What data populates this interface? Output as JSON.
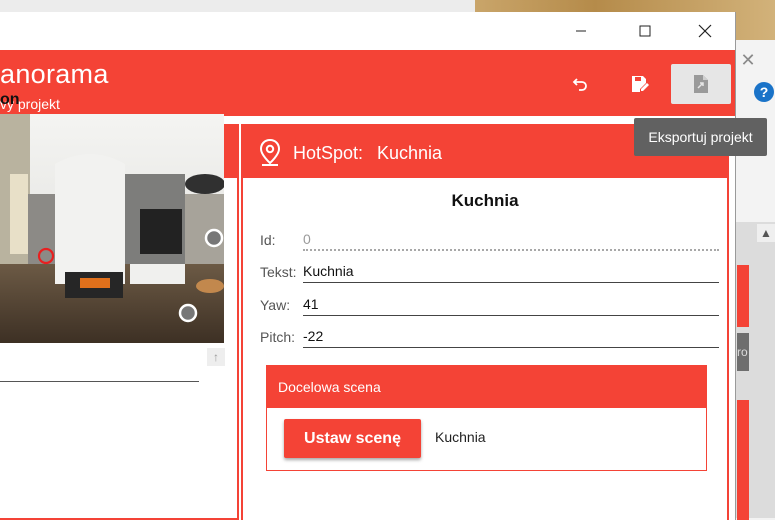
{
  "app": {
    "title": "anorama",
    "subtitle": "vy projekt"
  },
  "toolbar": {
    "undo_icon": "undo-icon",
    "save_icon": "save-edit-icon",
    "export_icon": "export-document-icon",
    "tooltip": "Eksportuj projekt"
  },
  "left_panel": {
    "title": "on"
  },
  "hotspot": {
    "header_label": "HotSpot:",
    "header_name": "Kuchnia",
    "heading": "Kuchnia",
    "fields": {
      "id": {
        "label": "Id:",
        "value": "0"
      },
      "text": {
        "label": "Tekst:",
        "value": "Kuchnia"
      },
      "yaw": {
        "label": "Yaw:",
        "value": "41"
      },
      "pitch": {
        "label": "Pitch:",
        "value": "-22"
      }
    },
    "target": {
      "header": "Docelowa scena",
      "button_label": "Ustaw scenę",
      "value": "Kuchnia"
    }
  },
  "background": {
    "help_glyph": "?",
    "side_text": "ro"
  },
  "colors": {
    "accent": "#f44336",
    "tooltip_bg": "#616161"
  }
}
